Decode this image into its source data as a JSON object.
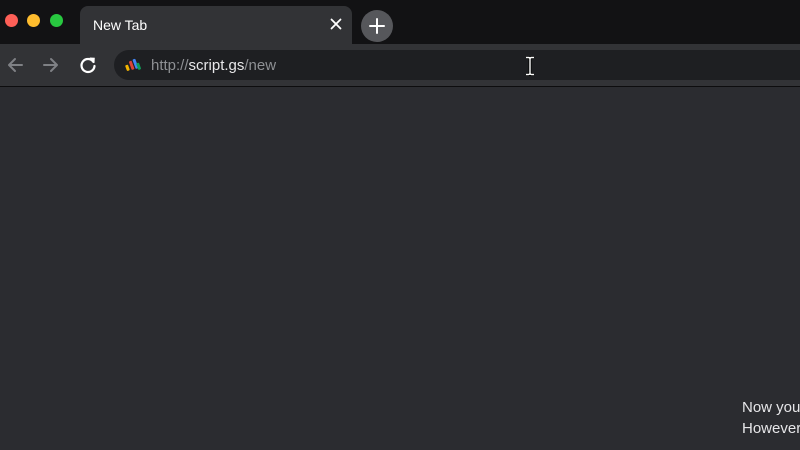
{
  "browser": {
    "tab": {
      "title": "New Tab"
    },
    "address_bar": {
      "scheme": "http://",
      "host": "script.gs",
      "path": "/new"
    },
    "icons": {
      "back": "arrow-left-icon",
      "forward": "arrow-right-icon",
      "reload": "reload-icon",
      "tab_close": "close-icon",
      "new_tab": "plus-icon",
      "favicon": "site-favicon-icon",
      "cursor": "text-cursor-icon"
    }
  },
  "content": {
    "caption_lines": [
      "Now you",
      "However"
    ]
  },
  "colors": {
    "window_close": "#fe5f57",
    "window_minimize": "#febc2e",
    "window_maximize": "#28c840",
    "page_background": "#2b2c30"
  }
}
